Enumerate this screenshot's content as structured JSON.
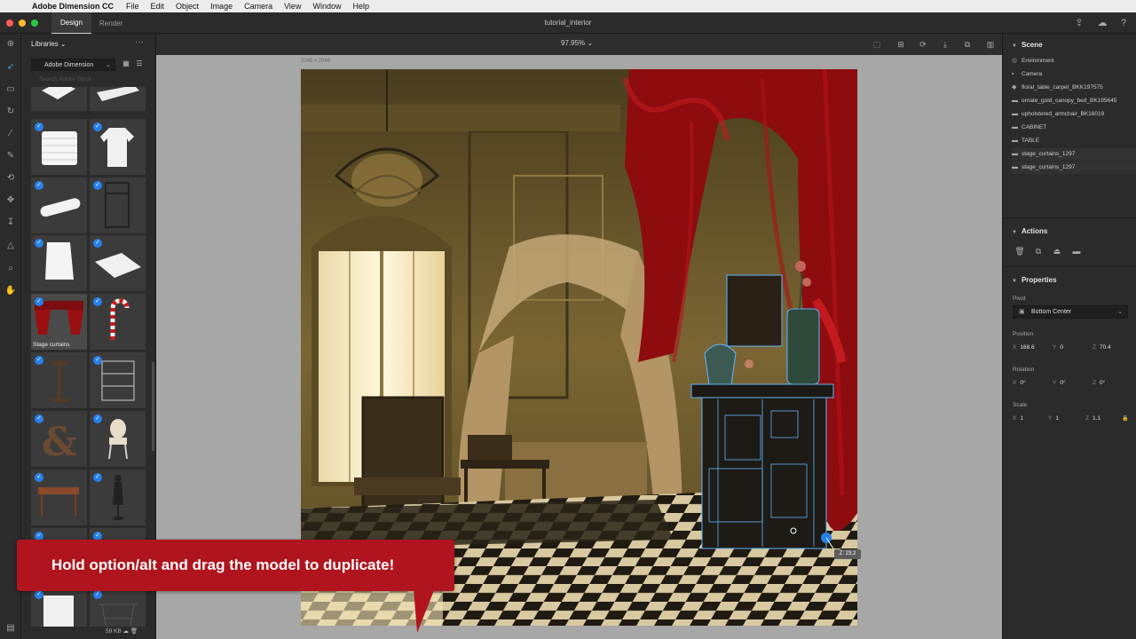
{
  "menubar": {
    "app_name": "Adobe Dimension CC",
    "items": [
      "File",
      "Edit",
      "Object",
      "Image",
      "Camera",
      "View",
      "Window",
      "Help"
    ]
  },
  "titlebar": {
    "tabs": [
      "Design",
      "Render"
    ],
    "active_tab": "Design",
    "document_title": "tutorial_interior"
  },
  "libraries": {
    "title": "Libraries",
    "selected_library": "Adobe Dimension",
    "search_placeholder": "Search Adobe Stock",
    "hovered_asset_caption": "Stage curtains",
    "footer_size": "59 KB"
  },
  "canvas": {
    "zoom": "97.95%",
    "document_size": "2048 x 2048",
    "measure_label": "Z: 23.2"
  },
  "callout": {
    "text": "Hold option/alt and drag the model to duplicate!"
  },
  "scene": {
    "title": "Scene",
    "items": [
      {
        "label": "Environment",
        "icon": "environment-icon",
        "selected": false
      },
      {
        "label": "Camera",
        "icon": "camera-icon",
        "selected": false
      },
      {
        "label": "floral_table_carpet_BKK197575",
        "icon": "model-icon",
        "selected": false
      },
      {
        "label": "ornate_gold_canopy_bed_BK195645",
        "icon": "folder-icon",
        "selected": false
      },
      {
        "label": "upholstered_armchair_BK16019",
        "icon": "folder-icon",
        "selected": false
      },
      {
        "label": "CABINET",
        "icon": "folder-icon",
        "selected": false
      },
      {
        "label": "TABLE",
        "icon": "folder-icon",
        "selected": false
      },
      {
        "label": "stage_curtains_1297",
        "icon": "folder-icon",
        "selected": true
      },
      {
        "label": "stage_curtains_1297",
        "icon": "folder-icon",
        "selected": true
      }
    ]
  },
  "actions": {
    "title": "Actions"
  },
  "properties": {
    "title": "Properties",
    "pivot_label": "Pivot",
    "pivot_value": "Bottom Center",
    "position_label": "Position",
    "position": {
      "x": "168.6",
      "y": "0",
      "z": "70.4"
    },
    "rotation_label": "Rotation",
    "rotation": {
      "x": "0°",
      "y": "0°",
      "z": "0°"
    },
    "scale_label": "Scale",
    "scale": {
      "x": "1",
      "y": "1",
      "z": "1.1"
    }
  },
  "colors": {
    "accent": "#2680eb",
    "callout": "#b0141e",
    "curtain": "#9a0f12",
    "selection_outline": "#5fb6ff"
  }
}
